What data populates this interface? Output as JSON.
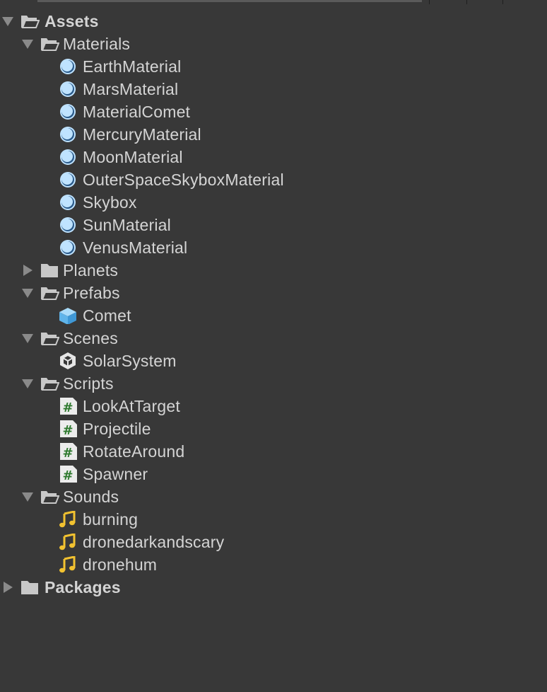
{
  "tree": {
    "assets": {
      "label": "Assets",
      "expanded": true,
      "children": {
        "materials": {
          "label": "Materials",
          "items": [
            "EarthMaterial",
            "MarsMaterial",
            "MaterialComet",
            "MercuryMaterial",
            "MoonMaterial",
            "OuterSpaceSkyboxMaterial",
            "Skybox",
            "SunMaterial",
            "VenusMaterial"
          ]
        },
        "planets": {
          "label": "Planets",
          "expanded": false
        },
        "prefabs": {
          "label": "Prefabs",
          "items": [
            "Comet"
          ]
        },
        "scenes": {
          "label": "Scenes",
          "items": [
            "SolarSystem"
          ]
        },
        "scripts": {
          "label": "Scripts",
          "items": [
            "LookAtTarget",
            "Projectile",
            "RotateAround",
            "Spawner"
          ]
        },
        "sounds": {
          "label": "Sounds",
          "items": [
            "burning",
            "dronedarkandscary",
            "dronehum"
          ]
        }
      }
    },
    "packages": {
      "label": "Packages",
      "expanded": false
    }
  },
  "colors": {
    "background": "#383838",
    "text": "#d4d4d4",
    "material_icon": "#bfe3ff",
    "prefab_icon": "#7fc8f5",
    "script_icon_bg": "#ececec",
    "script_hash": "#2f7a2f",
    "audio_icon": "#f2c230",
    "folder_icon": "#c8c8c8"
  },
  "icons": {
    "folder_open": "folder-open-icon",
    "folder_closed": "folder-icon",
    "material": "material-icon",
    "prefab": "prefab-icon",
    "scene": "scene-icon",
    "script": "script-icon",
    "audio": "audio-icon"
  }
}
